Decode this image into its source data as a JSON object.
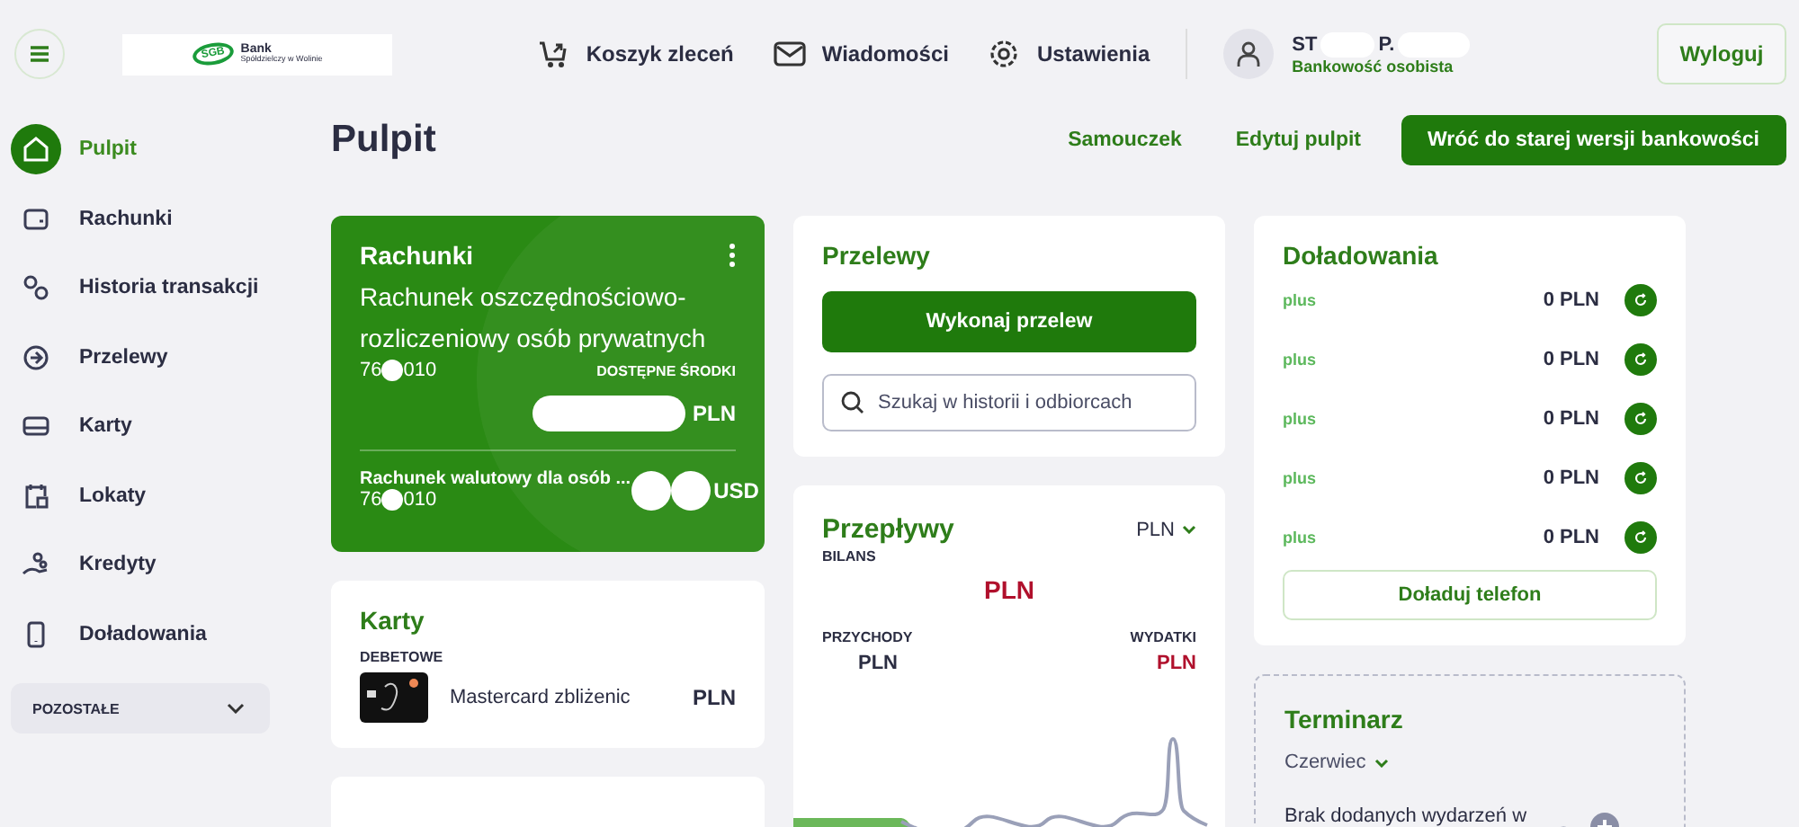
{
  "header": {
    "logo": {
      "name": "Bank",
      "subtitle": "Spółdzielczy w Wolinie",
      "mark": "SGB"
    },
    "nav": [
      {
        "label": "Koszyk zleceń"
      },
      {
        "label": "Wiadomości"
      },
      {
        "label": "Ustawienia"
      }
    ],
    "user": {
      "name_start": "ST",
      "name_end": "P.",
      "role": "Bankowość osobista"
    },
    "logout": "Wyloguj"
  },
  "sidebar": {
    "items": [
      {
        "label": "Pulpit",
        "selected": true
      },
      {
        "label": "Rachunki",
        "selected": false
      },
      {
        "label": "Historia transakcji",
        "selected": false
      },
      {
        "label": "Przelewy",
        "selected": false
      },
      {
        "label": "Karty",
        "selected": false
      },
      {
        "label": "Lokaty",
        "selected": false
      },
      {
        "label": "Kredyty",
        "selected": false
      },
      {
        "label": "Doładowania",
        "selected": false
      }
    ],
    "more": {
      "label": "POZOSTAŁE",
      "expanded": false
    }
  },
  "page": {
    "title": "Pulpit",
    "actions": [
      {
        "label": "Samouczek",
        "kind": "link"
      },
      {
        "label": "Edytuj pulpit",
        "kind": "link"
      },
      {
        "label": "Wróć do starej wersji bankowości",
        "kind": "primary"
      }
    ]
  },
  "accounts": {
    "title": "Rachunki",
    "main": {
      "name": "Rachunek oszczędnościowo-rozliczeniowy osób prywatnych",
      "number_start": "76",
      "number_end": "010",
      "available_label": "DOSTĘPNE ŚRODKI",
      "currency": "PLN"
    },
    "other": {
      "name": "Rachunek walutowy dla osób ...",
      "number_start": "76",
      "number_end": "010",
      "currency": "USD"
    }
  },
  "cards": {
    "title": "Karty",
    "group": "DEBETOWE",
    "items": [
      {
        "name": "Mastercard zbliżenic",
        "currency": "PLN"
      }
    ]
  },
  "transfers": {
    "title": "Przelewy",
    "button": "Wykonaj przelew",
    "search": {
      "placeholder": "Szukaj w historii i odbiorcach"
    }
  },
  "flows": {
    "title": "Przepływy",
    "currency": "PLN",
    "balance_label": "BILANS",
    "balance": "PLN",
    "income_label": "PRZYCHODY",
    "income": "PLN",
    "expenses_label": "WYDATKI",
    "expenses": "PLN"
  },
  "topups": {
    "title": "Doładowania",
    "items": [
      {
        "operator": "plus",
        "amount": "0 PLN"
      },
      {
        "operator": "plus",
        "amount": "0 PLN"
      },
      {
        "operator": "plus",
        "amount": "0 PLN"
      },
      {
        "operator": "plus",
        "amount": "0 PLN"
      },
      {
        "operator": "plus",
        "amount": "0 PLN"
      }
    ],
    "button": "Doładuj telefon"
  },
  "calendar": {
    "title": "Terminarz",
    "month": "Czerwiec",
    "empty": "Brak dodanych wydarzeń w"
  }
}
